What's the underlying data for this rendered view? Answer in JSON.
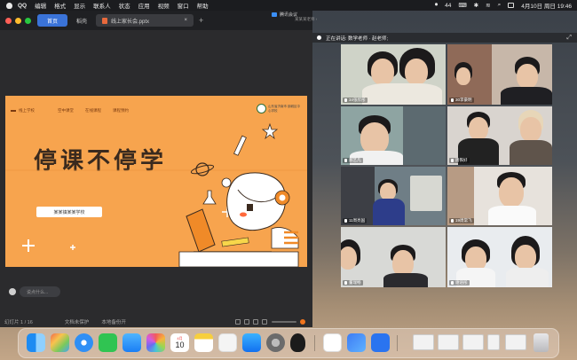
{
  "menubar": {
    "app_name": "QQ",
    "menus": [
      "编辑",
      "格式",
      "显示",
      "联系人",
      "状态",
      "应用",
      "视频",
      "窗口",
      "帮助"
    ],
    "battery": "44",
    "datetime": "4月10日 周日  19:46"
  },
  "editor": {
    "tabs": {
      "home": "首页",
      "doc": "稻壳",
      "file": "线上家长会.pptx"
    },
    "slide": {
      "nav": [
        "线上学校",
        "空中课堂",
        "在线课程",
        "课程预约"
      ],
      "logo_text": "山东省济南市 钢城区中心学校",
      "title": "停课不停学",
      "school": "某某镇某某学校"
    },
    "comment_placeholder": "说点什么...",
    "status": {
      "page": "幻灯片 1 / 16",
      "backup": "文档未保护",
      "save": "本地备份开"
    }
  },
  "meeting": {
    "app": "腾讯会议",
    "host": "某某某老师 ›",
    "speaker_label": "正在讲话: 数学老师 · 赵老师;",
    "participants": [
      "34张欣彤",
      "30李豪明",
      "郝艺凡",
      "周铁好",
      "11周亮国",
      "19周常飞",
      "董瑞畅",
      "谢语彤"
    ]
  },
  "dock": {
    "apps": [
      "finder-icon",
      "launchpad-icon",
      "safari-icon",
      "messages-icon",
      "mail-icon",
      "photos-icon",
      "calendar-icon",
      "notes-icon",
      "pages-icon",
      "appstore-icon",
      "settings-icon",
      "qq-icon",
      "wps-icon",
      "lark-icon",
      "tencent-meeting-icon",
      "trash-icon"
    ],
    "calendar_month": "4月",
    "calendar_day": "10"
  }
}
